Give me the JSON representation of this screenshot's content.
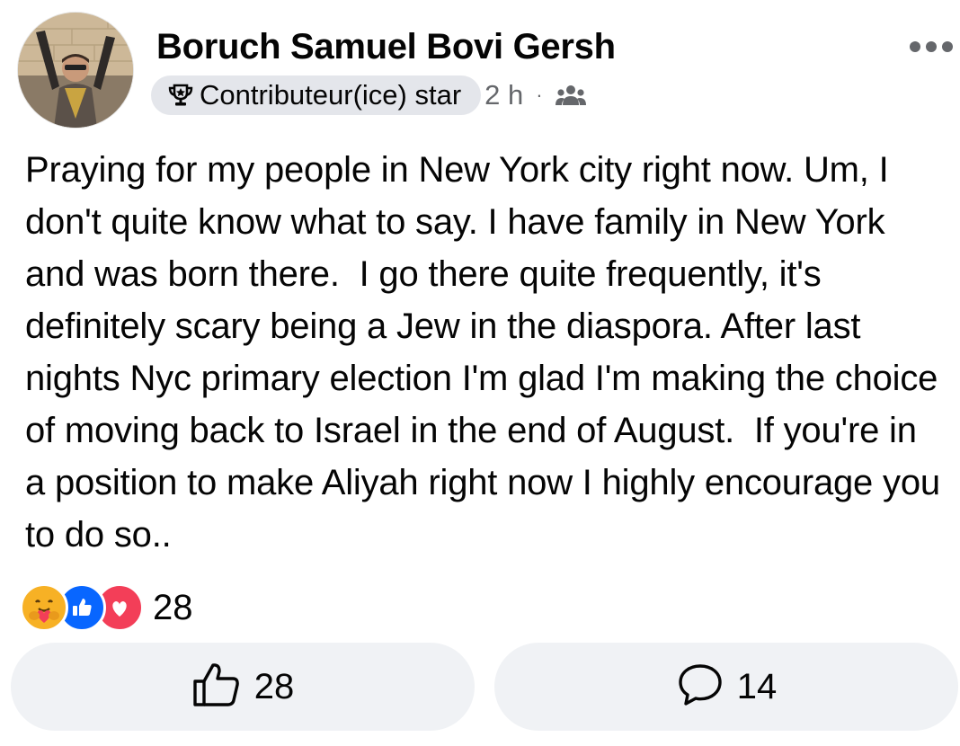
{
  "post": {
    "author": "Boruch Samuel Bovi Gersh",
    "badge_label": "Contributeur(ice) star",
    "time": "2 h",
    "separator": "·",
    "audience_icon": "friends-icon",
    "text": "Praying for my people in New York city right now. Um, I don't quite know what to say. I have family in New York and was born there.  I go there quite frequently, it's definitely scary being a Jew in the diaspora. After last nights Nyc primary election I'm glad I'm making the choice of moving back to Israel in the end of August.  If you're in a position to make Aliyah right now I highly encourage you to do so.."
  },
  "reactions": {
    "types": [
      "care",
      "like",
      "love"
    ],
    "count": "28"
  },
  "actions": {
    "like_count": "28",
    "comment_count": "14"
  },
  "colors": {
    "like": "#0866ff",
    "love": "#f33e58",
    "care": "#f7b125",
    "button_bg": "#f0f2f5",
    "secondary_text": "#65676b"
  }
}
